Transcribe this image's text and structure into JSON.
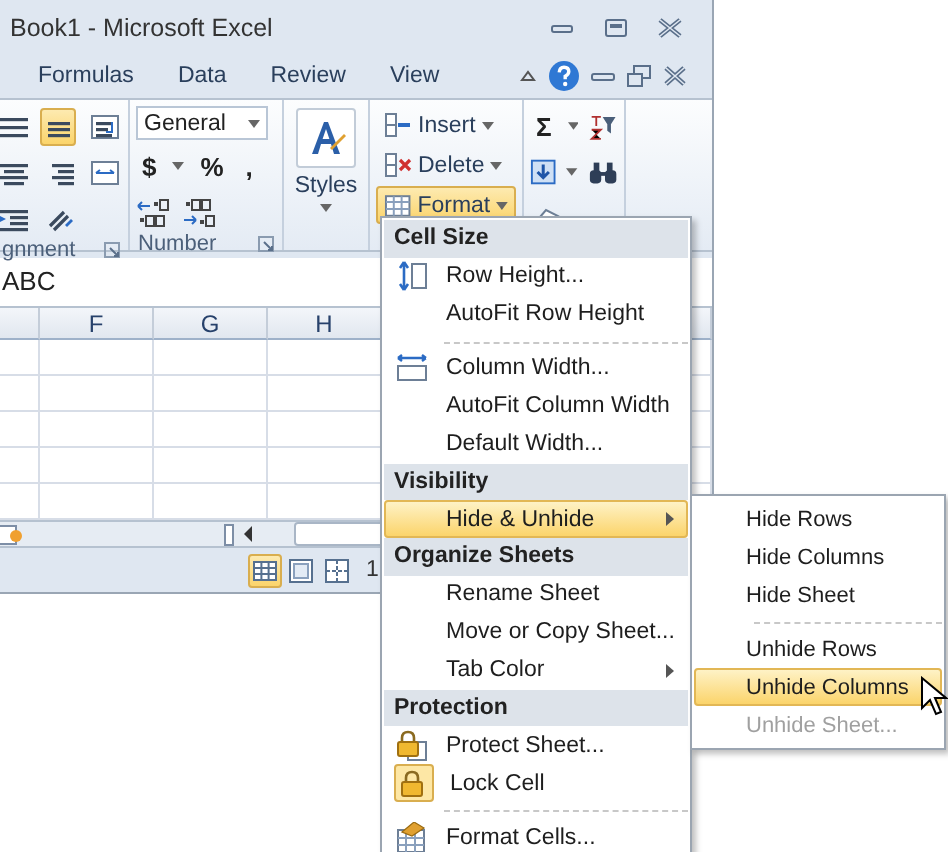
{
  "window": {
    "title": "Book1  -  Microsoft Excel"
  },
  "ribbon_tabs": [
    {
      "label": "Formulas",
      "selected": false
    },
    {
      "label": "Data",
      "selected": false
    },
    {
      "label": "Review",
      "selected": false
    },
    {
      "label": "View",
      "selected": false
    }
  ],
  "ribbon": {
    "alignment": {
      "label": "gnment",
      "buttons": [
        {
          "selected": false
        },
        {
          "selected": true
        },
        {
          "selected": false
        },
        {
          "selected": false
        },
        {
          "selected": false
        },
        {
          "selected": false
        },
        {
          "selected": false
        },
        {
          "selected": false
        }
      ]
    },
    "number": {
      "format": "General",
      "symbols": [
        "$",
        "%",
        ","
      ],
      "label": "Number"
    },
    "styles": {
      "label": "Styles"
    },
    "cells": [
      {
        "label": "Insert",
        "pressed": false
      },
      {
        "label": "Delete",
        "pressed": false
      },
      {
        "label": "Format",
        "pressed": true
      }
    ],
    "editing": {
      "sum": "Σ"
    }
  },
  "formula_bar": {
    "value": "ABC"
  },
  "columns": [
    "F",
    "G",
    "H"
  ],
  "status_bar": {
    "views": [
      {
        "selected": true
      },
      {
        "selected": false
      },
      {
        "selected": false
      }
    ],
    "zoom": "1"
  },
  "format_menu": [
    {
      "kind": "header",
      "label": "Cell Size"
    },
    {
      "kind": "item",
      "label": "Row Height...",
      "selected": false,
      "checked": false,
      "submenu": false
    },
    {
      "kind": "item",
      "label": "AutoFit Row Height",
      "selected": false,
      "checked": false,
      "submenu": false
    },
    {
      "kind": "separator"
    },
    {
      "kind": "item",
      "label": "Column Width...",
      "selected": false,
      "checked": false,
      "submenu": false
    },
    {
      "kind": "item",
      "label": "AutoFit Column Width",
      "selected": false,
      "checked": false,
      "submenu": false
    },
    {
      "kind": "item",
      "label": "Default Width...",
      "selected": false,
      "checked": false,
      "submenu": false
    },
    {
      "kind": "header",
      "label": "Visibility"
    },
    {
      "kind": "item",
      "label": "Hide & Unhide",
      "selected": true,
      "checked": false,
      "submenu": true
    },
    {
      "kind": "header",
      "label": "Organize Sheets"
    },
    {
      "kind": "item",
      "label": "Rename Sheet",
      "selected": false,
      "checked": false,
      "submenu": false
    },
    {
      "kind": "item",
      "label": "Move or Copy Sheet...",
      "selected": false,
      "checked": false,
      "submenu": false
    },
    {
      "kind": "item",
      "label": "Tab Color",
      "selected": false,
      "checked": false,
      "submenu": true
    },
    {
      "kind": "header",
      "label": "Protection"
    },
    {
      "kind": "item",
      "label": "Protect Sheet...",
      "selected": false,
      "checked": false,
      "submenu": false
    },
    {
      "kind": "item",
      "label": "Lock Cell",
      "selected": false,
      "checked": true,
      "submenu": false
    },
    {
      "kind": "separator"
    },
    {
      "kind": "item",
      "label": "Format Cells...",
      "selected": false,
      "checked": false,
      "submenu": false
    }
  ],
  "submenu": [
    {
      "kind": "item",
      "label": "Hide Rows",
      "selected": false,
      "disabled": false
    },
    {
      "kind": "item",
      "label": "Hide Columns",
      "selected": false,
      "disabled": false
    },
    {
      "kind": "item",
      "label": "Hide Sheet",
      "selected": false,
      "disabled": false
    },
    {
      "kind": "separator"
    },
    {
      "kind": "item",
      "label": "Unhide Rows",
      "selected": false,
      "disabled": false
    },
    {
      "kind": "item",
      "label": "Unhide Columns",
      "selected": true,
      "disabled": false
    },
    {
      "kind": "item",
      "label": "Unhide Sheet...",
      "selected": false,
      "disabled": true
    }
  ]
}
